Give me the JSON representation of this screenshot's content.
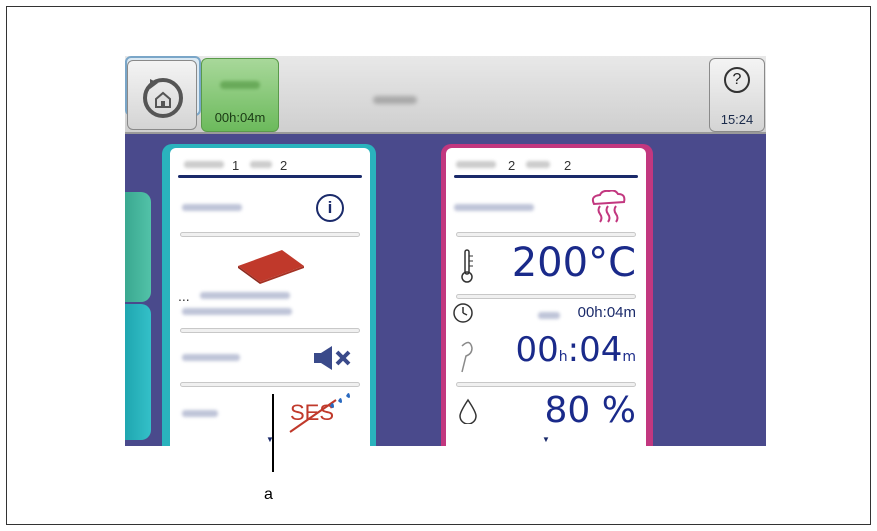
{
  "topbar": {
    "program_time": "00h:04m",
    "clock": "15:24",
    "help_icon_text": "?"
  },
  "left_panel": {
    "step_current": "1",
    "step_total": "2",
    "info_icon_text": "i",
    "ellipsis_text": "...",
    "ses_label": "SES"
  },
  "right_panel": {
    "step_current": "2",
    "step_total": "2",
    "temperature": "200°C",
    "time_small": "00h:04m",
    "time_big_hours": "00",
    "time_big_h_unit": "h",
    "time_big_sep": ":",
    "time_big_minutes": "04",
    "time_big_m_unit": "m",
    "humidity": "80 %"
  },
  "annotation": {
    "label": "a"
  },
  "colors": {
    "screen_bg": "#4a4a8c",
    "left_border": "#2ab3bd",
    "right_border": "#c2377f",
    "value_text": "#1a2a8a",
    "time_button": "#6cba5c"
  }
}
